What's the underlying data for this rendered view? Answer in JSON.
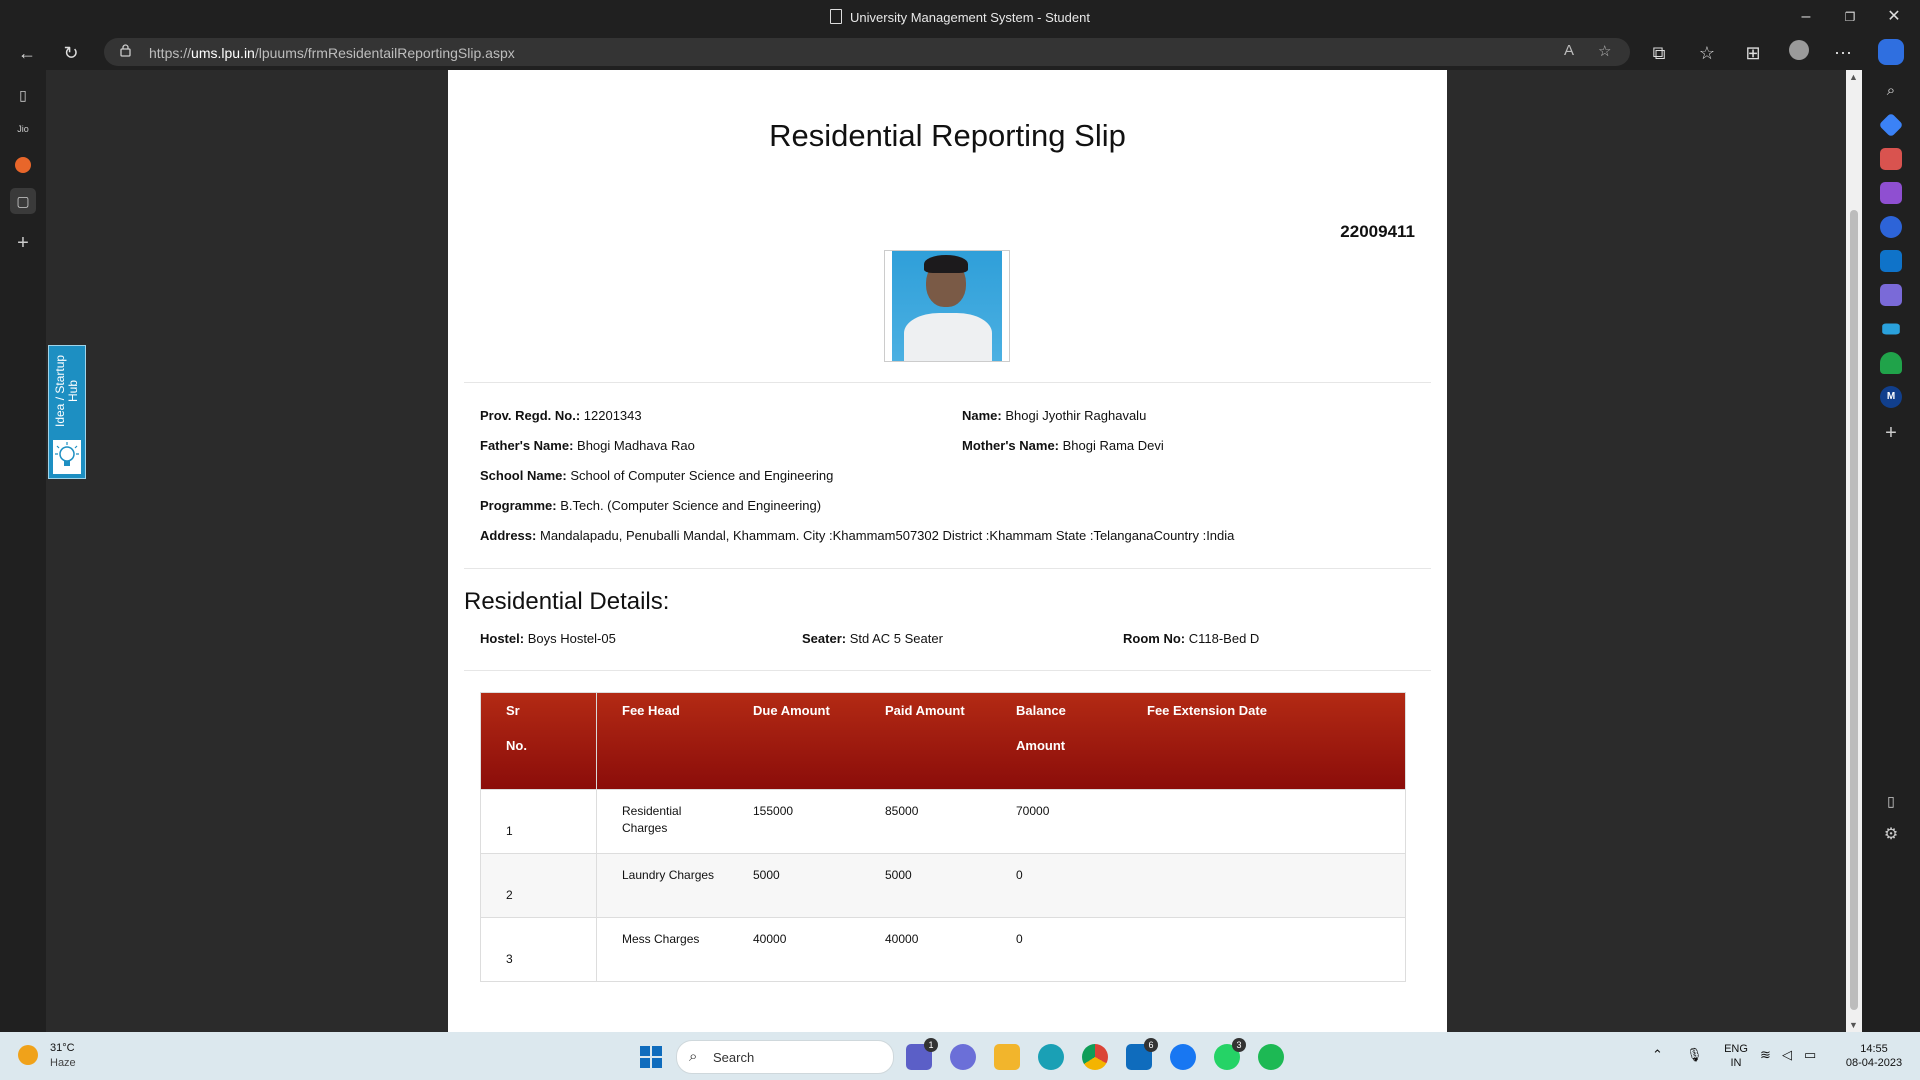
{
  "window": {
    "title": "University Management System - Student"
  },
  "browser": {
    "url_prefix": "https://",
    "url_host": "ums.lpu.in",
    "url_path": "/lpuums/frmResidentailReportingSlip.aspx"
  },
  "idea_tab": {
    "label": "Idea / Startup Hub"
  },
  "slip": {
    "title": "Residential Reporting Slip",
    "reg_no": "22009411",
    "prov_regd_label": "Prov. Regd. No.:",
    "prov_regd_value": "12201343",
    "name_label": "Name:",
    "name_value": "Bhogi Jyothir Raghavalu",
    "father_label": "Father's Name:",
    "father_value": "Bhogi Madhava Rao",
    "mother_label": "Mother's Name:",
    "mother_value": "Bhogi Rama Devi",
    "school_label": "School Name:",
    "school_value": "School of Computer Science and Engineering",
    "programme_label": "Programme:",
    "programme_value": "B.Tech. (Computer Science and Engineering)",
    "address_label": "Address:",
    "address_value": "Mandalapadu, Penuballi Mandal, Khammam. City :Khammam507302 District :Khammam State :TelanganaCountry :India"
  },
  "residential": {
    "title": "Residential Details:",
    "hostel_label": "Hostel:",
    "hostel_value": "Boys Hostel-05",
    "seater_label": "Seater:",
    "seater_value": "Std AC 5 Seater",
    "room_label": "Room No:",
    "room_value": "C118-Bed D"
  },
  "fee_table": {
    "headers": {
      "sr_1": "Sr",
      "sr_2": "No.",
      "fee_head": "Fee Head",
      "due": "Due Amount",
      "paid": "Paid Amount",
      "balance_1": "Balance",
      "balance_2": "Amount",
      "extension": "Fee Extension Date"
    },
    "rows": [
      {
        "sr": "1",
        "fee_head_1": "Residential",
        "fee_head_2": "Charges",
        "due": "155000",
        "paid": "85000",
        "balance": "70000",
        "extension": ""
      },
      {
        "sr": "2",
        "fee_head_1": "Laundry Charges",
        "fee_head_2": "",
        "due": "5000",
        "paid": "5000",
        "balance": "0",
        "extension": ""
      },
      {
        "sr": "3",
        "fee_head_1": "Mess Charges",
        "fee_head_2": "",
        "due": "40000",
        "paid": "40000",
        "balance": "0",
        "extension": ""
      }
    ]
  },
  "taskbar": {
    "weather_temp": "31°C",
    "weather_desc": "Haze",
    "search_label": "Search",
    "badge_teams": "1",
    "badge_mail": "6",
    "badge_whatsapp": "3",
    "lang_1": "ENG",
    "lang_2": "IN",
    "time": "14:55",
    "date": "08-04-2023"
  },
  "colors": {
    "table_header_top": "#b32a14",
    "table_header_bottom": "#8b0d0a",
    "browser_chrome": "#202020",
    "taskbar": "#dce8ee"
  }
}
